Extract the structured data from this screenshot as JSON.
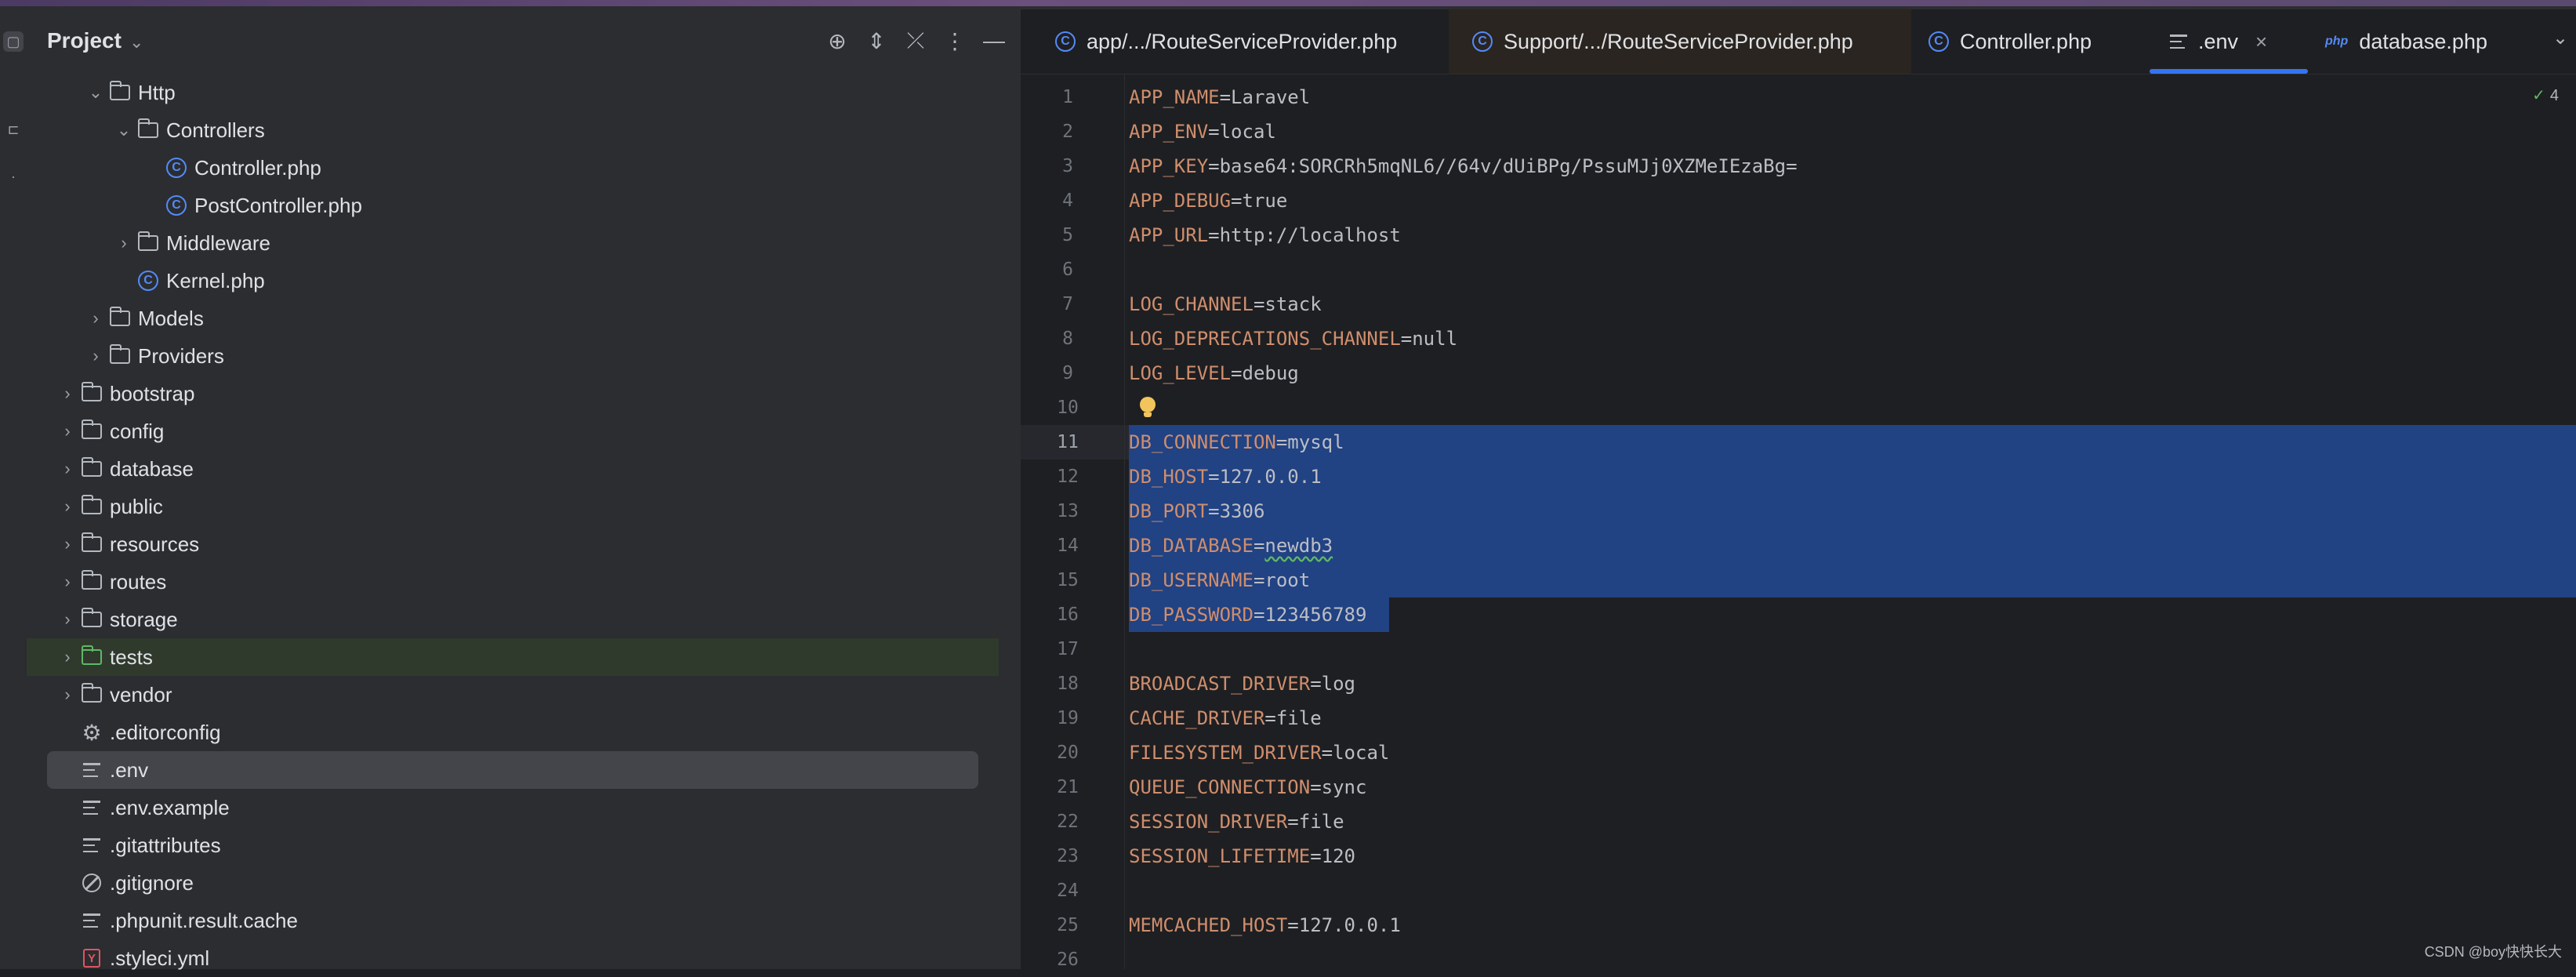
{
  "project_panel": {
    "title": "Project",
    "tree": [
      {
        "label": "Http",
        "type": "folder",
        "depth": 3,
        "expanded": true
      },
      {
        "label": "Controllers",
        "type": "folder",
        "depth": 4,
        "expanded": true
      },
      {
        "label": "Controller.php",
        "type": "php",
        "depth": 5
      },
      {
        "label": "PostController.php",
        "type": "php",
        "depth": 5
      },
      {
        "label": "Middleware",
        "type": "folder",
        "depth": 4,
        "expanded": false
      },
      {
        "label": "Kernel.php",
        "type": "php",
        "depth": 4
      },
      {
        "label": "Models",
        "type": "folder",
        "depth": 3,
        "expanded": false
      },
      {
        "label": "Providers",
        "type": "folder",
        "depth": 3,
        "expanded": false
      },
      {
        "label": "bootstrap",
        "type": "folder",
        "depth": 2,
        "expanded": false
      },
      {
        "label": "config",
        "type": "folder",
        "depth": 2,
        "expanded": false
      },
      {
        "label": "database",
        "type": "folder",
        "depth": 2,
        "expanded": false
      },
      {
        "label": "public",
        "type": "folder",
        "depth": 2,
        "expanded": false
      },
      {
        "label": "resources",
        "type": "folder",
        "depth": 2,
        "expanded": false
      },
      {
        "label": "routes",
        "type": "folder",
        "depth": 2,
        "expanded": false
      },
      {
        "label": "storage",
        "type": "folder",
        "depth": 2,
        "expanded": false
      },
      {
        "label": "tests",
        "type": "folder-green",
        "depth": 2,
        "expanded": false
      },
      {
        "label": "vendor",
        "type": "folder",
        "depth": 2,
        "expanded": false
      },
      {
        "label": ".editorconfig",
        "type": "gear",
        "depth": 2
      },
      {
        "label": ".env",
        "type": "lines",
        "depth": 2,
        "selected": true
      },
      {
        "label": ".env.example",
        "type": "lines",
        "depth": 2
      },
      {
        "label": ".gitattributes",
        "type": "lines",
        "depth": 2
      },
      {
        "label": ".gitignore",
        "type": "ignore",
        "depth": 2
      },
      {
        "label": ".phpunit.result.cache",
        "type": "lines",
        "depth": 2
      },
      {
        "label": ".styleci.yml",
        "type": "yml",
        "depth": 2
      }
    ]
  },
  "tabs": [
    {
      "label": "app/.../RouteServiceProvider.php",
      "icon": "php-class-icon"
    },
    {
      "label": "Support/.../RouteServiceProvider.php",
      "icon": "php-class-icon",
      "highlighted": true
    },
    {
      "label": "Controller.php",
      "icon": "php-class-icon"
    },
    {
      "label": ".env",
      "icon": "text-file-icon",
      "active": true
    },
    {
      "label": "database.php",
      "icon": "php-file-icon",
      "icon_text": "php"
    }
  ],
  "editor": {
    "inspection_count": "4",
    "current_line": 11,
    "lines": [
      {
        "n": "1",
        "key": "APP_NAME",
        "val": "Laravel"
      },
      {
        "n": "2",
        "key": "APP_ENV",
        "val": "local"
      },
      {
        "n": "3",
        "key": "APP_KEY",
        "val": "base64:SORCRh5mqNL6//64v/dUiBPg/PssuMJj0XZMeIEzaBg="
      },
      {
        "n": "4",
        "key": "APP_DEBUG",
        "val": "true"
      },
      {
        "n": "5",
        "key": "APP_URL",
        "val": "http://localhost"
      },
      {
        "n": "6",
        "key": "",
        "val": ""
      },
      {
        "n": "7",
        "key": "LOG_CHANNEL",
        "val": "stack"
      },
      {
        "n": "8",
        "key": "LOG_DEPRECATIONS_CHANNEL",
        "val": "null"
      },
      {
        "n": "9",
        "key": "LOG_LEVEL",
        "val": "debug"
      },
      {
        "n": "10",
        "key": "",
        "val": ""
      },
      {
        "n": "11",
        "key": "DB_CONNECTION",
        "val": "mysql"
      },
      {
        "n": "12",
        "key": "DB_HOST",
        "val": "127.0.0.1"
      },
      {
        "n": "13",
        "key": "DB_PORT",
        "val": "3306"
      },
      {
        "n": "14",
        "key": "DB_DATABASE",
        "val": "newdb3"
      },
      {
        "n": "15",
        "key": "DB_USERNAME",
        "val": "root"
      },
      {
        "n": "16",
        "key": "DB_PASSWORD",
        "val": "123456789"
      },
      {
        "n": "17",
        "key": "",
        "val": ""
      },
      {
        "n": "18",
        "key": "BROADCAST_DRIVER",
        "val": "log"
      },
      {
        "n": "19",
        "key": "CACHE_DRIVER",
        "val": "file"
      },
      {
        "n": "20",
        "key": "FILESYSTEM_DRIVER",
        "val": "local"
      },
      {
        "n": "21",
        "key": "QUEUE_CONNECTION",
        "val": "sync"
      },
      {
        "n": "22",
        "key": "SESSION_DRIVER",
        "val": "file"
      },
      {
        "n": "23",
        "key": "SESSION_LIFETIME",
        "val": "120"
      },
      {
        "n": "24",
        "key": "",
        "val": ""
      },
      {
        "n": "25",
        "key": "MEMCACHED_HOST",
        "val": "127.0.0.1"
      },
      {
        "n": "26",
        "key": "",
        "val": ""
      }
    ]
  },
  "watermark": "CSDN @boy快快长大",
  "colors": {
    "selection": "#214283",
    "accent": "#3574f0",
    "key": "#cf8e6d"
  }
}
